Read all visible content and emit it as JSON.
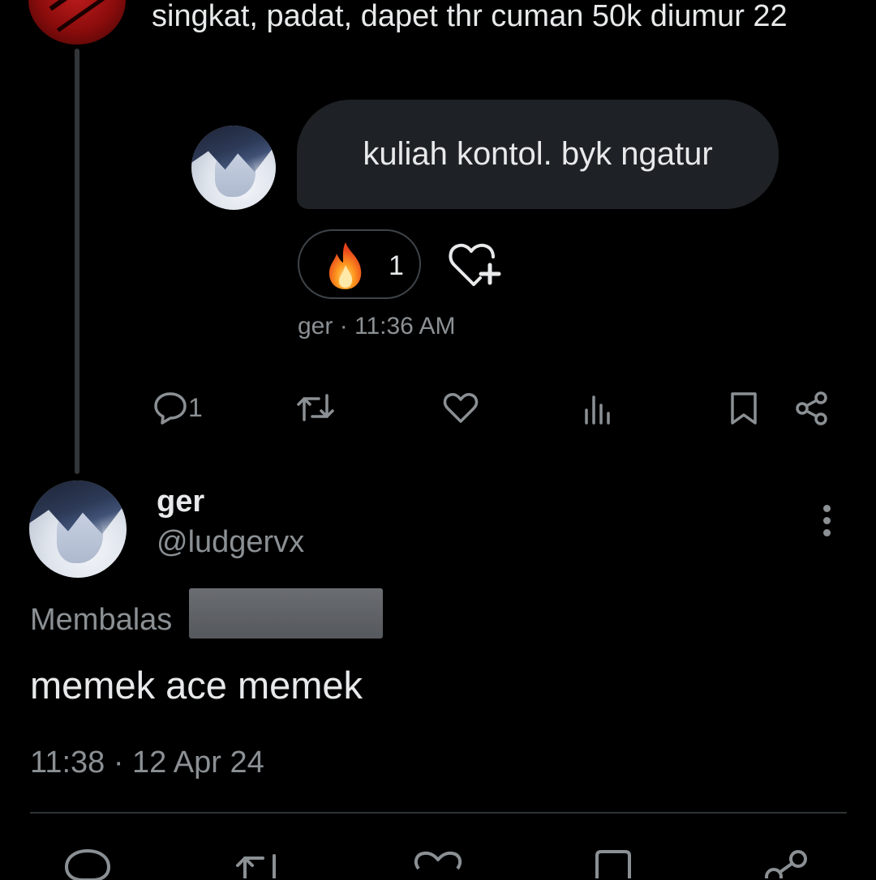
{
  "parent_tweet": {
    "text": "singkat, padat, dapet thr cuman 50k diumur 22"
  },
  "dm_message": {
    "text": "kuliah kontol. byk ngatur",
    "reaction_count": "1",
    "reaction_icon": "fire-emoji",
    "meta": "ger · 11:36 AM"
  },
  "parent_actions": {
    "reply_count": "1"
  },
  "reply_tweet": {
    "display_name": "ger",
    "handle": "@ludgervx",
    "replying_to_label": "Membalas",
    "text": "memek ace memek",
    "timestamp": "11:38 · 12 Apr 24"
  },
  "colors": {
    "background": "#000000",
    "text_primary": "#e7e9ea",
    "text_secondary": "#8b9094",
    "bubble": "#1e2226",
    "divider": "#2f3336"
  }
}
